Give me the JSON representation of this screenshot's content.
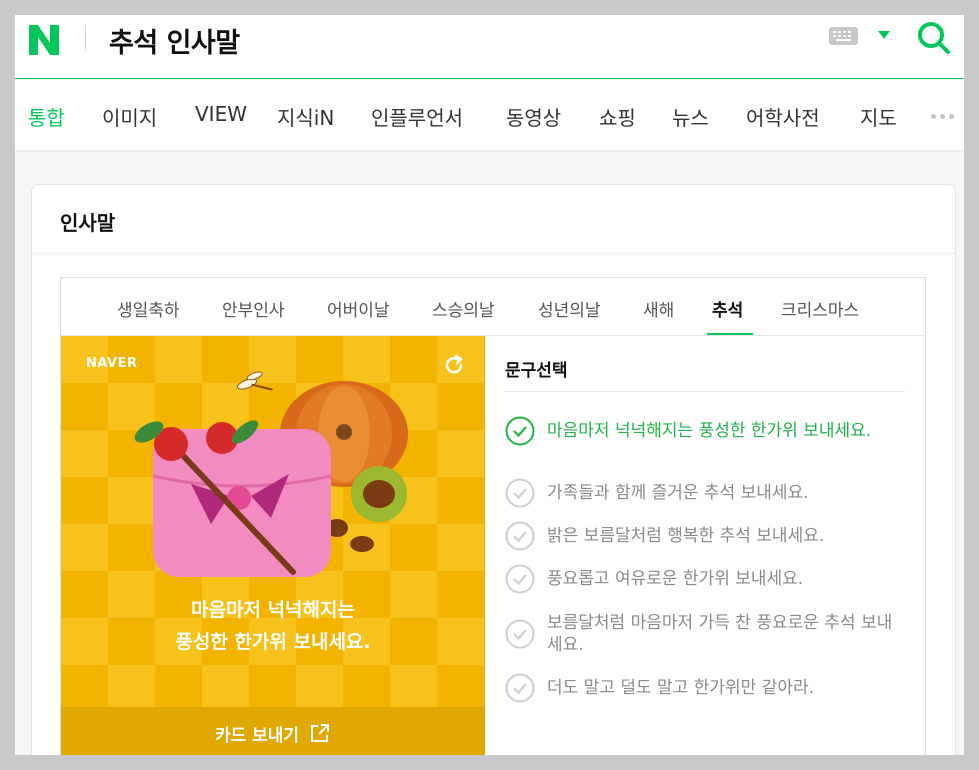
{
  "search": {
    "logo_letter": "N",
    "query": "추석 인사말",
    "keyboard_icon": "keyboard-icon",
    "search_icon": "search-icon",
    "accent_color": "#03c75a"
  },
  "tabs": [
    {
      "label": "통합",
      "active": true
    },
    {
      "label": "이미지"
    },
    {
      "label": "VIEW"
    },
    {
      "label": "지식iN"
    },
    {
      "label": "인플루언서"
    },
    {
      "label": "동영상"
    },
    {
      "label": "쇼핑"
    },
    {
      "label": "뉴스"
    },
    {
      "label": "어학사전"
    },
    {
      "label": "지도"
    }
  ],
  "card": {
    "title": "인사말",
    "categories": [
      {
        "label": "생일축하"
      },
      {
        "label": "안부인사"
      },
      {
        "label": "어버이날"
      },
      {
        "label": "스승의날"
      },
      {
        "label": "성년의날"
      },
      {
        "label": "새해"
      },
      {
        "label": "추석",
        "active": true
      },
      {
        "label": "크리스마스"
      }
    ],
    "greeting_card": {
      "brand": "NAVER",
      "message_line1": "마음마저 넉넉해지는",
      "message_line2": "풍성한 한가위 보내세요.",
      "send_label": "카드 보내기",
      "background": "#f2b400"
    },
    "phrase_panel": {
      "title": "문구선택",
      "phrases": [
        {
          "text": "마음마저 넉넉해지는 풍성한 한가위 보내세요.",
          "selected": true
        },
        {
          "text": "가족들과 함께 즐거운 추석 보내세요."
        },
        {
          "text": "밝은 보름달처럼 행복한 추석 보내세요."
        },
        {
          "text": "풍요롭고 여유로운 한가위 보내세요."
        },
        {
          "text": "보름달처럼 마음마저 가득 찬 풍요로운 추석 보내세요."
        },
        {
          "text": "더도 말고 덜도 말고 한가위만 같아라."
        }
      ]
    }
  }
}
